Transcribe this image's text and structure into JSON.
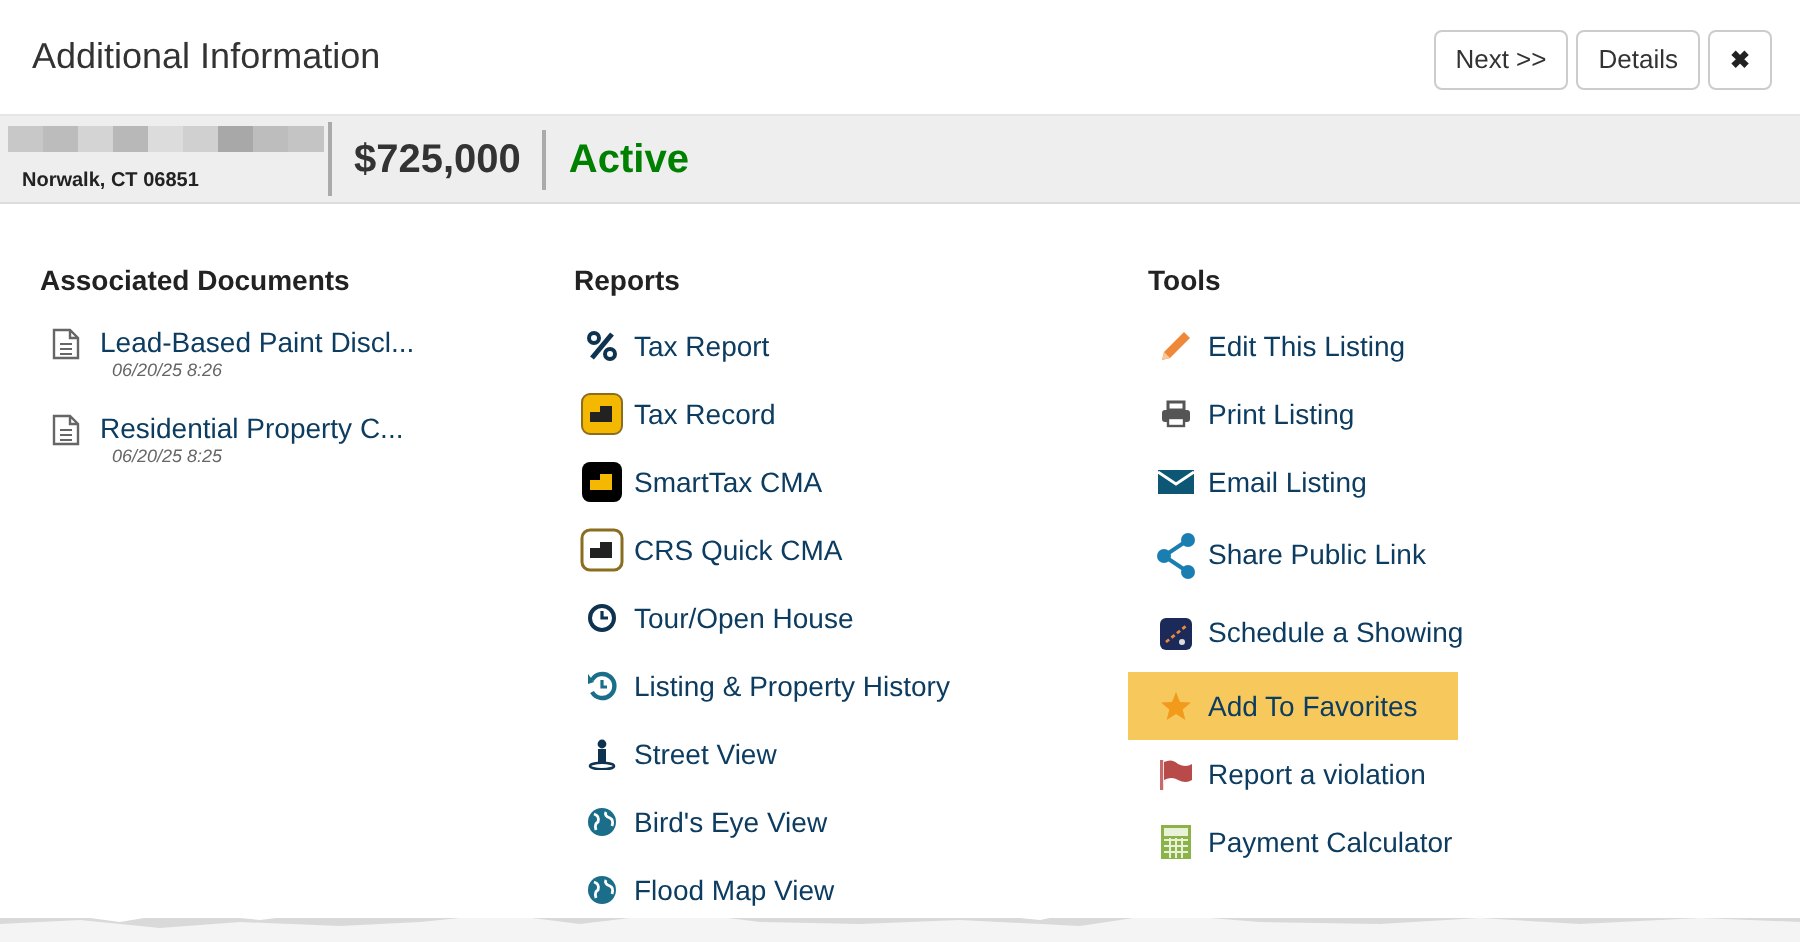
{
  "window": {
    "title": "Additional Information"
  },
  "header_buttons": [
    {
      "kind": "text",
      "label": "Next >>"
    },
    {
      "kind": "text",
      "label": "Details"
    },
    {
      "kind": "close",
      "label": "✖"
    }
  ],
  "listing": {
    "location": "Norwalk, CT 06851",
    "price": "$725,000",
    "status": "Active"
  },
  "documents": {
    "heading": "Associated Documents",
    "items": [
      {
        "title": "Lead-Based Paint Discl...",
        "date": "06/20/25 8:26"
      },
      {
        "title": "Residential Property C...",
        "date": "06/20/25 8:25"
      }
    ]
  },
  "reports": {
    "heading": "Reports",
    "items": [
      {
        "kind": "percent",
        "label": "Tax Report"
      },
      {
        "kind": "tax-record",
        "label": "Tax Record"
      },
      {
        "kind": "smarttax",
        "label": "SmartTax CMA"
      },
      {
        "kind": "crs",
        "label": "CRS Quick CMA"
      },
      {
        "kind": "clock",
        "label": "Tour/Open House"
      },
      {
        "kind": "history",
        "label": "Listing & Property History"
      },
      {
        "kind": "person",
        "label": "Street View"
      },
      {
        "kind": "globe",
        "label": "Bird's Eye View"
      },
      {
        "kind": "globe",
        "label": "Flood Map View"
      }
    ]
  },
  "tools": {
    "heading": "Tools",
    "items": [
      {
        "kind": "pencil",
        "label": "Edit This Listing",
        "highlighted": false
      },
      {
        "kind": "printer",
        "label": "Print Listing",
        "highlighted": false
      },
      {
        "kind": "envelope",
        "label": "Email Listing",
        "highlighted": false
      },
      {
        "kind": "share",
        "label": "Share Public Link",
        "highlighted": false
      },
      {
        "kind": "calendar",
        "label": "Schedule a Showing",
        "highlighted": false
      },
      {
        "kind": "star",
        "label": "Add To Favorites",
        "highlighted": true
      },
      {
        "kind": "flag",
        "label": "Report a violation",
        "highlighted": false
      },
      {
        "kind": "calculator",
        "label": "Payment Calculator",
        "highlighted": false
      }
    ]
  }
}
